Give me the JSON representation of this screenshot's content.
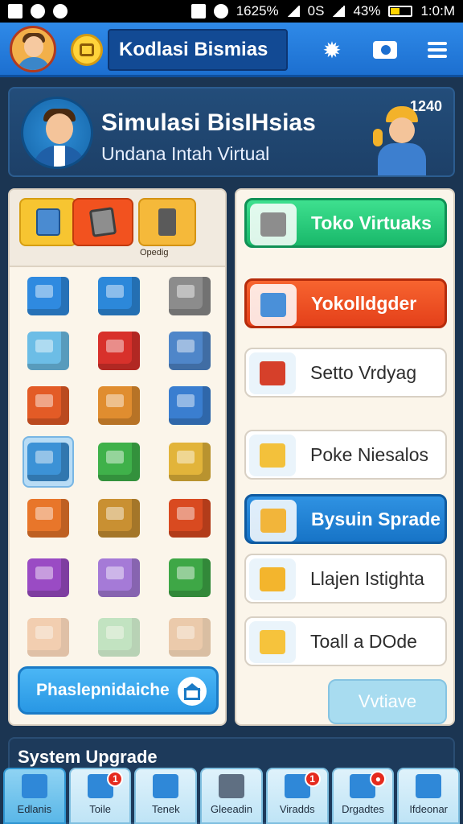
{
  "status_bar": {
    "carrier_info": "1625%",
    "network": "0S",
    "battery": "43%",
    "battery_level": 0.43,
    "time": "1:0:M"
  },
  "header": {
    "title": "Kodlasi Bismias",
    "icons": [
      "avatar",
      "bag-icon",
      "gear-icon",
      "camera-icon",
      "menu-icon"
    ]
  },
  "banner": {
    "title": "Simulasi BisIHsias",
    "subtitle": "Undana Intah Virtual",
    "value": "1240"
  },
  "category_tabs": {
    "tabs": [
      "books",
      "tablet",
      "pencil-cup"
    ],
    "label": "Opedig"
  },
  "item_grid": {
    "rows": [
      [
        {
          "icon": "box-blue",
          "color": "#2f8ae0"
        },
        {
          "icon": "bag-blue",
          "color": "#2c88da"
        },
        {
          "icon": "printer",
          "color": "#8c8c8c"
        }
      ],
      [
        {
          "icon": "crate-lightblue",
          "color": "#6cbde6"
        },
        {
          "icon": "case-red",
          "color": "#d8312b"
        },
        {
          "icon": "box-steel",
          "color": "#4f86c9"
        }
      ],
      [
        {
          "icon": "crate-orange",
          "color": "#e35b26"
        },
        {
          "icon": "folder-orange",
          "color": "#e08d2f"
        },
        {
          "icon": "server-blue",
          "color": "#3a7ed0"
        }
      ],
      [
        {
          "icon": "cabinet-blue",
          "color": "#3c92d6"
        },
        {
          "icon": "printer-green",
          "color": "#3fb14a"
        },
        {
          "icon": "coins-stack",
          "color": "#e2b43a"
        }
      ],
      [
        {
          "icon": "box-orange",
          "color": "#e8762a"
        },
        {
          "icon": "shelf-green",
          "color": "#c99032"
        },
        {
          "icon": "box-red",
          "color": "#d94a20"
        }
      ],
      [
        {
          "icon": "box-purple",
          "color": "#9a4bc4"
        },
        {
          "icon": "box-violet",
          "color": "#a57ad7"
        },
        {
          "icon": "box-green",
          "color": "#3ea746"
        }
      ],
      [
        {
          "icon": "box-peach",
          "color": "#e89f6a"
        },
        {
          "icon": "box-mint",
          "color": "#7fcf90"
        },
        {
          "icon": "box-tan",
          "color": "#d9985f"
        }
      ]
    ],
    "selected_index": [
      3,
      0
    ],
    "cta_label": "Phaslepnidaiche"
  },
  "menu": {
    "items": [
      {
        "label": "Toko Virtuaks",
        "style": "green",
        "icon": "store-icon",
        "icon_color": "#8d8d8d"
      },
      {
        "label": "Yokolldgder",
        "style": "red",
        "icon": "pencil-cup-icon",
        "icon_color": "#4a90d9"
      },
      {
        "label": "Setto Vrdyag",
        "style": "white",
        "icon": "shop-icon",
        "icon_color": "#d6402a"
      },
      {
        "label": "Poke Niesalos",
        "style": "white",
        "icon": "coins-icon",
        "icon_color": "#f3c13b"
      },
      {
        "label": "Bysuin Sprade",
        "style": "blue",
        "icon": "box-upgrade-icon",
        "icon_color": "#f2b53a"
      },
      {
        "label": "Llajen Istighta",
        "style": "white",
        "icon": "magnifier-icon",
        "icon_color": "#f3b52d"
      },
      {
        "label": "Toall a DOde",
        "style": "white",
        "icon": "document-icon",
        "icon_color": "#f6c33c"
      }
    ],
    "faded_button": "Vvtiave"
  },
  "system": {
    "label": "System Upgrade"
  },
  "tabbar": {
    "tabs": [
      {
        "label": "Edlanis",
        "icon": "home-icon",
        "icon_color": "#2f88d8",
        "badge": ""
      },
      {
        "label": "Toile",
        "icon": "store-icon",
        "icon_color": "#2f88d8",
        "badge": "1"
      },
      {
        "label": "Tenek",
        "icon": "star-icon",
        "icon_color": "#2f88d8",
        "badge": ""
      },
      {
        "label": "Gleeadin",
        "icon": "gear-icon",
        "icon_color": "#5f6f82",
        "badge": ""
      },
      {
        "label": "Viradds",
        "icon": "rocket-icon",
        "icon_color": "#2f88d8",
        "badge": "1"
      },
      {
        "label": "Drgadtes",
        "icon": "grid-icon",
        "icon_color": "#2f88d8",
        "badge": "●"
      },
      {
        "label": "Ifdeonar",
        "icon": "database-icon",
        "icon_color": "#2f88d8",
        "badge": ""
      }
    ]
  },
  "colors": {
    "background": "#1b3552",
    "header": "#2f8ae8",
    "accent_green": "#19b86a",
    "accent_red": "#e4401a",
    "accent_blue": "#1774c7"
  }
}
